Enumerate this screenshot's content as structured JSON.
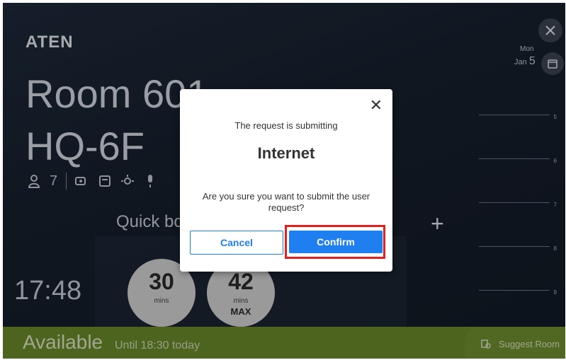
{
  "brand": {
    "logo": "ATEN"
  },
  "room": {
    "line1": "Room 601",
    "line2": "HQ-6F"
  },
  "amenities": {
    "capacity": "7"
  },
  "date": {
    "day": "Mon",
    "month": "Jan",
    "date": "5"
  },
  "quick_book": {
    "title": "Quick bo",
    "option1_value": "30",
    "option1_unit": "mins",
    "option2_value": "42",
    "option2_unit": "mins",
    "option2_extra": "MAX"
  },
  "clock": "17:48",
  "timeline": {
    "hours": [
      "5",
      "6",
      "7",
      "8",
      "9"
    ]
  },
  "status": {
    "label": "Available",
    "until": "Until 18:30 today"
  },
  "suggest": {
    "label": "Suggest Room"
  },
  "modal": {
    "message": "The request is submitting",
    "title": "Internet",
    "question": "Are you sure you want to submit the user request?",
    "cancel_label": "Cancel",
    "confirm_label": "Confirm"
  },
  "icons": {
    "tools": "tools-icon",
    "calendar": "calendar-icon",
    "person": "person-icon",
    "camera": "camera-icon",
    "display": "display-icon",
    "light": "light-icon",
    "mic": "microphone-icon",
    "close": "close-icon",
    "plus": "plus-icon",
    "suggest": "suggest-room-icon"
  },
  "colors": {
    "available_bar": "#6b8b2a",
    "primary_button": "#1f7ff0",
    "highlight": "#e02020"
  }
}
